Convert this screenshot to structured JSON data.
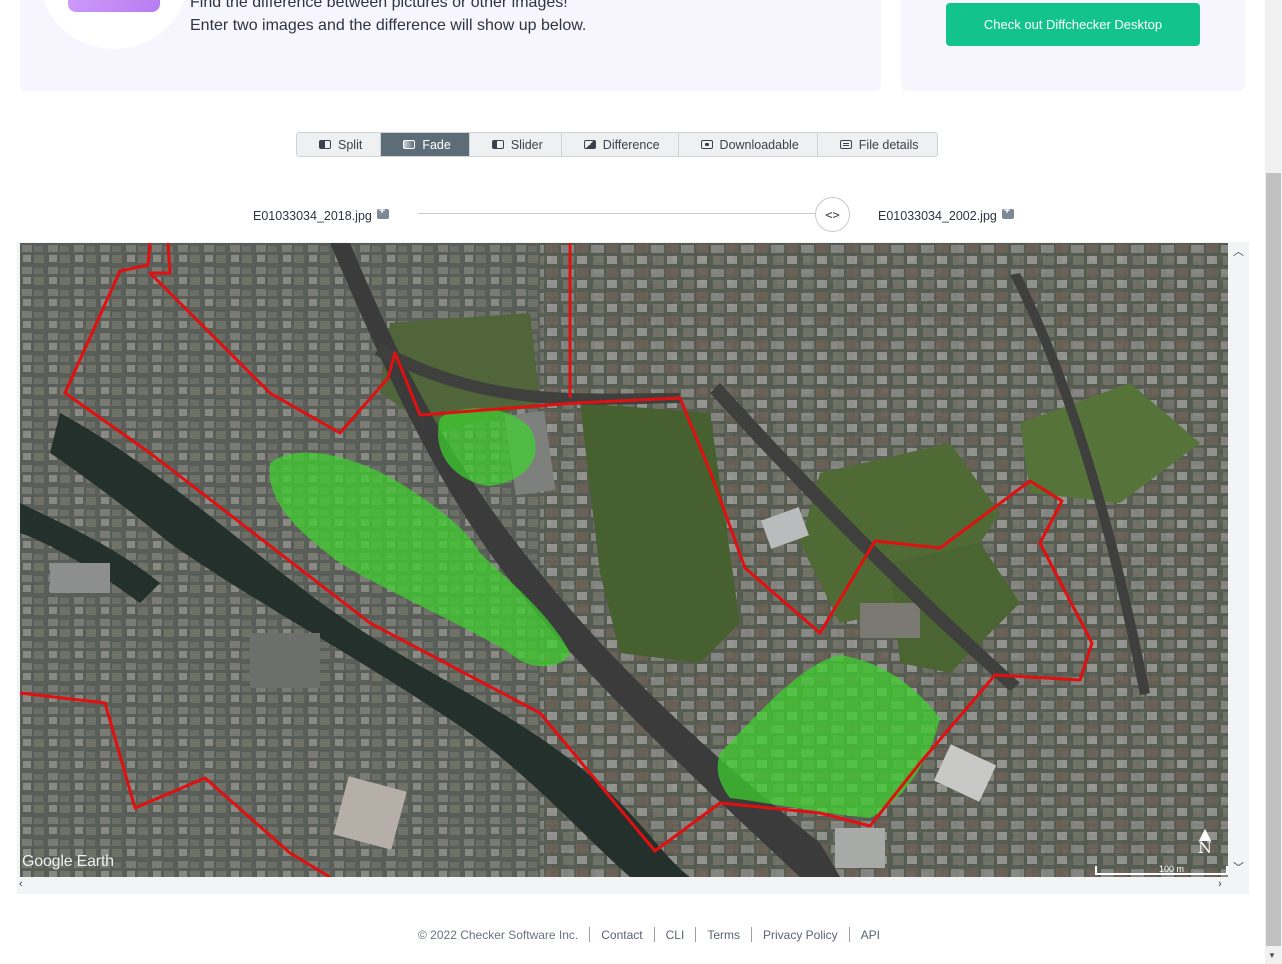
{
  "hero": {
    "line1": "Find the difference between pictures or other images!",
    "line2": "Enter two images and the difference will show up below."
  },
  "promo": {
    "button_label": "Check out Diffchecker Desktop"
  },
  "tabs": [
    {
      "label": "Split",
      "icon": "split-view-icon",
      "active": false
    },
    {
      "label": "Fade",
      "icon": "fade-view-icon",
      "active": true
    },
    {
      "label": "Slider",
      "icon": "slider-view-icon",
      "active": false
    },
    {
      "label": "Difference",
      "icon": "difference-view-icon",
      "active": false
    },
    {
      "label": "Downloadable",
      "icon": "downloadable-icon",
      "active": false
    },
    {
      "label": "File details",
      "icon": "file-details-icon",
      "active": false
    }
  ],
  "compare": {
    "left_file": "E01033034_2018.jpg",
    "right_file": "E01033034_2002.jpg",
    "handle_label": "<>"
  },
  "map": {
    "watermark": "Google Earth",
    "scale_label": "100 m",
    "north_label": "N"
  },
  "colors": {
    "brand_green": "#12c48b",
    "tab_active": "#5d6d78",
    "boundary_red": "#e01010",
    "diff_green": "#3fd22e"
  },
  "footer": {
    "copyright": "© 2022 Checker Software Inc.",
    "links": [
      "Contact",
      "CLI",
      "Terms",
      "Privacy Policy",
      "API"
    ]
  }
}
